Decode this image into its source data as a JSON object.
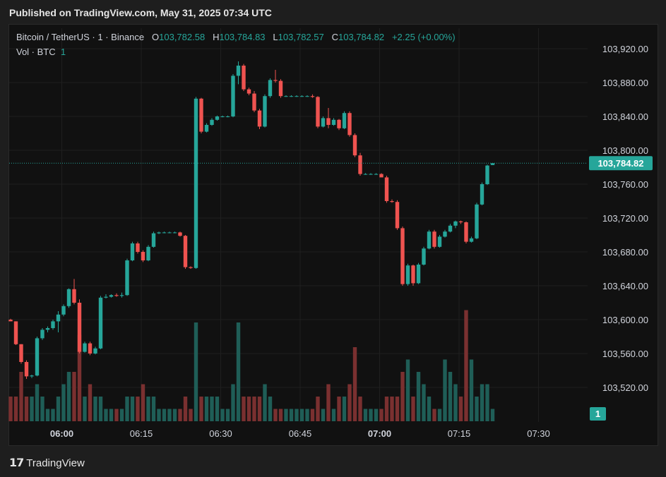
{
  "publish_note": "Published on TradingView.com, May 31, 2025 07:34 UTC",
  "legend": {
    "symbol": "Bitcoin / TetherUS · 1 · Binance",
    "o_label": "O",
    "o": "103,782.58",
    "h_label": "H",
    "h": "103,784.83",
    "l_label": "L",
    "l": "103,782.57",
    "c_label": "C",
    "c": "103,784.82",
    "change": "+2.25 (+0.00%)",
    "vol_label": "Vol · BTC",
    "vol_value": "1"
  },
  "footer": {
    "brand": "TradingView"
  },
  "colors": {
    "up": "#26a69a",
    "down": "#ef5350",
    "vol_up": "#1f5e57",
    "vol_down": "#7a3030",
    "grid": "#1f1f1f",
    "bg": "#111111"
  },
  "chart_data": {
    "type": "candlestick",
    "title": "Bitcoin / TetherUS · 1 · Binance",
    "x_ticks": [
      "06:00",
      "06:15",
      "06:30",
      "06:45",
      "07:00",
      "07:15",
      "07:30"
    ],
    "y_ticks": [
      "103,920.00",
      "103,880.00",
      "103,840.00",
      "103,800.00",
      "103,760.00",
      "103,720.00",
      "103,680.00",
      "103,640.00",
      "103,600.00",
      "103,560.00",
      "103,520.00"
    ],
    "ylim": [
      103490,
      103930
    ],
    "last_price": 103784.82,
    "last_price_label": "103,784.82",
    "volume_label": "1",
    "candles": [
      [
        103600,
        103601,
        103599,
        103598,
        2
      ],
      [
        103598,
        103598,
        103570,
        103571,
        2
      ],
      [
        103571,
        103571,
        103548,
        103550,
        4
      ],
      [
        103550,
        103552,
        103530,
        103533,
        2
      ],
      [
        103533,
        103535,
        103531,
        103534,
        2
      ],
      [
        103534,
        103580,
        103533,
        103578,
        3
      ],
      [
        103578,
        103590,
        103576,
        103588,
        2
      ],
      [
        103588,
        103592,
        103585,
        103590,
        1
      ],
      [
        103590,
        103600,
        103588,
        103598,
        1
      ],
      [
        103598,
        103610,
        103585,
        103606,
        2
      ],
      [
        103606,
        103618,
        103604,
        103616,
        3
      ],
      [
        103616,
        103637,
        103614,
        103636,
        4
      ],
      [
        103636,
        103648,
        103618,
        103620,
        4
      ],
      [
        103620,
        103624,
        103560,
        103562,
        7
      ],
      [
        103562,
        103574,
        103561,
        103572,
        2
      ],
      [
        103572,
        103574,
        103558,
        103560,
        3
      ],
      [
        103560,
        103568,
        103559,
        103566,
        2
      ],
      [
        103566,
        103628,
        103565,
        103626,
        2
      ],
      [
        103626,
        103630,
        103625,
        103627,
        1
      ],
      [
        103627,
        103630,
        103626,
        103629,
        1
      ],
      [
        103629,
        103631,
        103627,
        103628,
        1
      ],
      [
        103628,
        103632,
        103626,
        103629,
        1
      ],
      [
        103629,
        103672,
        103628,
        103670,
        2
      ],
      [
        103670,
        103692,
        103669,
        103690,
        2
      ],
      [
        103690,
        103692,
        103678,
        103680,
        2
      ],
      [
        103680,
        103682,
        103668,
        103670,
        3
      ],
      [
        103670,
        103688,
        103669,
        103686,
        2
      ],
      [
        103686,
        103704,
        103685,
        103702,
        2
      ],
      [
        103702,
        103704,
        103701,
        103703,
        1
      ],
      [
        103703,
        103704,
        103702,
        103703,
        1
      ],
      [
        103703,
        103704,
        103702,
        103703,
        1
      ],
      [
        103703,
        103704,
        103702,
        103703,
        1
      ],
      [
        103703,
        103704,
        103698,
        103699,
        1
      ],
      [
        103699,
        103700,
        103660,
        103662,
        2
      ],
      [
        103662,
        103663,
        103660,
        103661,
        1
      ],
      [
        103661,
        103863,
        103660,
        103861,
        8
      ],
      [
        103861,
        103862,
        103820,
        103822,
        2
      ],
      [
        103822,
        103832,
        103821,
        103830,
        2
      ],
      [
        103830,
        103838,
        103829,
        103836,
        2
      ],
      [
        103836,
        103841,
        103835,
        103840,
        2
      ],
      [
        103840,
        103841,
        103839,
        103840,
        1
      ],
      [
        103840,
        103841,
        103839,
        103840,
        1
      ],
      [
        103840,
        103890,
        103839,
        103888,
        3
      ],
      [
        103888,
        103905,
        103878,
        103900,
        8
      ],
      [
        103900,
        103902,
        103870,
        103872,
        2
      ],
      [
        103872,
        103874,
        103865,
        103867,
        2
      ],
      [
        103867,
        103870,
        103845,
        103847,
        2
      ],
      [
        103847,
        103849,
        103825,
        103828,
        2
      ],
      [
        103828,
        103866,
        103827,
        103864,
        3
      ],
      [
        103864,
        103885,
        103862,
        103883,
        2
      ],
      [
        103883,
        103895,
        103880,
        103882,
        1
      ],
      [
        103882,
        103884,
        103862,
        103864,
        1
      ],
      [
        103864,
        103865,
        103863,
        103864,
        1
      ],
      [
        103864,
        103865,
        103863,
        103864,
        1
      ],
      [
        103864,
        103865,
        103863,
        103864,
        1
      ],
      [
        103864,
        103865,
        103863,
        103864,
        1
      ],
      [
        103864,
        103865,
        103863,
        103864,
        1
      ],
      [
        103864,
        103866,
        103862,
        103863,
        1
      ],
      [
        103863,
        103864,
        103826,
        103828,
        2
      ],
      [
        103828,
        103840,
        103827,
        103838,
        1
      ],
      [
        103838,
        103850,
        103826,
        103830,
        3
      ],
      [
        103830,
        103838,
        103829,
        103836,
        1
      ],
      [
        103836,
        103837,
        103824,
        103826,
        2
      ],
      [
        103826,
        103846,
        103825,
        103844,
        2
      ],
      [
        103844,
        103846,
        103816,
        103818,
        3
      ],
      [
        103818,
        103820,
        103792,
        103794,
        6
      ],
      [
        103794,
        103797,
        103770,
        103772,
        2
      ],
      [
        103772,
        103773,
        103771,
        103772,
        1
      ],
      [
        103772,
        103773,
        103771,
        103772,
        1
      ],
      [
        103772,
        103773,
        103771,
        103772,
        1
      ],
      [
        103772,
        103773,
        103769,
        103768,
        1
      ],
      [
        103768,
        103770,
        103738,
        103740,
        2
      ],
      [
        103740,
        103742,
        103738,
        103739,
        2
      ],
      [
        103739,
        103741,
        103706,
        103708,
        2
      ],
      [
        103708,
        103710,
        103640,
        103642,
        4
      ],
      [
        103642,
        103666,
        103640,
        103664,
        5
      ],
      [
        103664,
        103665,
        103640,
        103643,
        2
      ],
      [
        103643,
        103667,
        103642,
        103665,
        4
      ],
      [
        103665,
        103686,
        103664,
        103684,
        3
      ],
      [
        103684,
        103706,
        103683,
        103704,
        2
      ],
      [
        103704,
        103706,
        103684,
        103686,
        1
      ],
      [
        103686,
        103700,
        103685,
        103698,
        1
      ],
      [
        103698,
        103706,
        103697,
        103704,
        5
      ],
      [
        103704,
        103713,
        103703,
        103711,
        4
      ],
      [
        103711,
        103717,
        103708,
        103716,
        3
      ],
      [
        103716,
        103717,
        103713,
        103715,
        2
      ],
      [
        103715,
        103716,
        103690,
        103692,
        9
      ],
      [
        103692,
        103698,
        103691,
        103696,
        5
      ],
      [
        103696,
        103738,
        103695,
        103736,
        2
      ],
      [
        103736,
        103762,
        103735,
        103760,
        3
      ],
      [
        103760,
        103783,
        103759,
        103782,
        3
      ],
      [
        103782.58,
        103784.83,
        103782.57,
        103784.82,
        1
      ]
    ]
  }
}
